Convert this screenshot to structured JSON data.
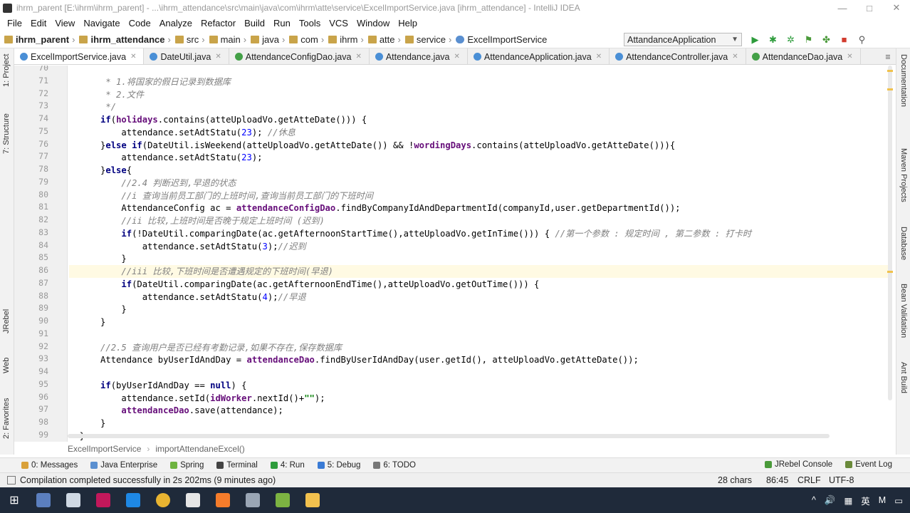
{
  "window": {
    "title": "ihrm_parent [E:\\ihrm\\ihrm_parent] - ...\\ihrm_attendance\\src\\main\\java\\com\\ihrm\\atte\\service\\ExcelImportService.java [ihrm_attendance] - IntelliJ IDEA"
  },
  "menu": [
    "File",
    "Edit",
    "View",
    "Navigate",
    "Code",
    "Analyze",
    "Refactor",
    "Build",
    "Run",
    "Tools",
    "VCS",
    "Window",
    "Help"
  ],
  "nav": {
    "crumbs": [
      "ihrm_parent",
      "ihrm_attendance",
      "src",
      "main",
      "java",
      "com",
      "ihrm",
      "atte",
      "service",
      "ExcelImportService"
    ],
    "run_config": "AttandanceApplication"
  },
  "tabs": [
    {
      "label": "ExcelImportService.java",
      "kind": "class"
    },
    {
      "label": "DateUtil.java",
      "kind": "class"
    },
    {
      "label": "AttendanceConfigDao.java",
      "kind": "interface"
    },
    {
      "label": "Attendance.java",
      "kind": "class"
    },
    {
      "label": "AttendanceApplication.java",
      "kind": "class"
    },
    {
      "label": "AttendanceController.java",
      "kind": "class"
    },
    {
      "label": "AttendanceDao.java",
      "kind": "interface"
    }
  ],
  "side_left": [
    "1: Project",
    "7: Structure",
    "JRebel",
    "Web",
    "2: Favorites"
  ],
  "side_right": [
    "Documentation",
    "Maven Projects",
    "Database",
    "Bean Validation",
    "Ant Build"
  ],
  "line_numbers": [
    "70",
    "71",
    "72",
    "73",
    "74",
    "75",
    "76",
    "77",
    "78",
    "79",
    "80",
    "81",
    "82",
    "83",
    "84",
    "85",
    "86",
    "87",
    "88",
    "89",
    "90",
    "91",
    "92",
    "93",
    "94",
    "95",
    "96",
    "97",
    "98",
    "99"
  ],
  "code": [
    "",
    "       * 1.将国家的假日记录到数据库",
    "       * 2.文件",
    "       */",
    "      if(holidays.contains(atteUploadVo.getAtteDate())) {",
    "          attendance.setAdtStatu(23); //休息",
    "      }else if(DateUtil.isWeekend(atteUploadVo.getAtteDate()) && !wordingDays.contains(atteUploadVo.getAtteDate())){",
    "          attendance.setAdtStatu(23);",
    "      }else{",
    "          //2.4 判断迟到,早退的状态",
    "          //i 查询当前员工部门的上班时间,查询当前员工部门的下班时间",
    "          AttendanceConfig ac = attendanceConfigDao.findByCompanyIdAndDepartmentId(companyId,user.getDepartmentId());",
    "          //ii 比较,上班时间是否晚于规定上班时间 (迟到)",
    "          if(!DateUtil.comparingDate(ac.getAfternoonStartTime(),atteUploadVo.getInTime())) { //第一个参数 : 规定时间 , 第二参数 : 打卡时",
    "              attendance.setAdtStatu(3);//迟到",
    "          }",
    "          //iii 比较,下班时间是否遭遇规定的下班时间(早退)",
    "          if(DateUtil.comparingDate(ac.getAfternoonEndTime(),atteUploadVo.getOutTime())) {",
    "              attendance.setAdtStatu(4);//早退",
    "          }",
    "      }",
    "",
    "      //2.5 查询用户是否已经有考勤记录,如果不存在,保存数据库",
    "      Attendance byUserIdAndDay = attendanceDao.findByUserIdAndDay(user.getId(), atteUploadVo.getAtteDate());",
    "",
    "      if(byUserIdAndDay == null) {",
    "          attendance.setId(idWorker.nextId()+\"\");",
    "          attendanceDao.save(attendance);",
    "      }",
    "  }"
  ],
  "editor_breadcrumb": [
    "ExcelImportService",
    "importAttendaneExcel()"
  ],
  "toolwindows_left": [
    "0: Messages",
    "Java Enterprise",
    "Spring",
    "Terminal",
    "4: Run",
    "5: Debug",
    "6: TODO"
  ],
  "toolwindows_right": [
    "JRebel Console",
    "Event Log"
  ],
  "status": {
    "message": "Compilation completed successfully in 2s 202ms (9 minutes ago)",
    "chars": "28 chars",
    "position": "86:45",
    "line_sep": "CRLF",
    "encoding": "UTF-8"
  },
  "tray": {
    "ime": "英",
    "ime2": "M"
  }
}
